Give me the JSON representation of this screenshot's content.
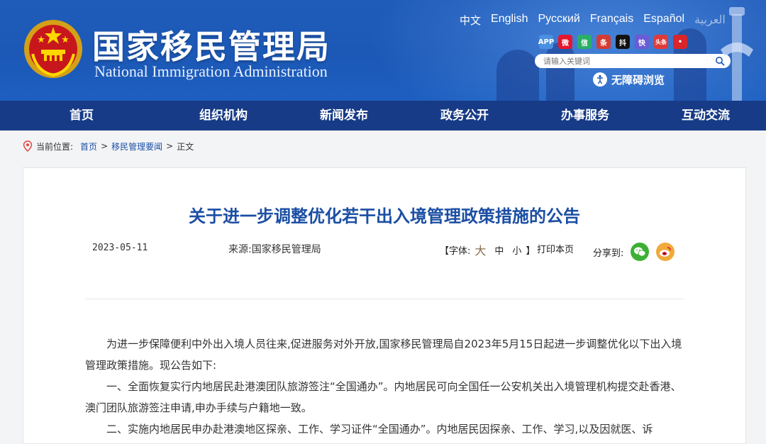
{
  "header": {
    "title_cn": "国家移民管理局",
    "title_en": "National Immigration Administration",
    "languages": [
      "中文",
      "English",
      "Русский",
      "Français",
      "Español",
      "العربية"
    ],
    "social_icons": [
      {
        "name": "app-icon",
        "label": "APP",
        "color": "#4a90e2"
      },
      {
        "name": "weibo-icon",
        "label": "微",
        "color": "#e6162d"
      },
      {
        "name": "wechat-icon",
        "label": "信",
        "color": "#2aae67"
      },
      {
        "name": "toutiao-icon",
        "label": "条",
        "color": "#d43c33"
      },
      {
        "name": "douyin-icon",
        "label": "抖",
        "color": "#111111"
      },
      {
        "name": "kuaishou-icon",
        "label": "快",
        "color": "#6b5bd6"
      },
      {
        "name": "toutiao-hao-icon",
        "label": "头条",
        "color": "#e03b3b"
      },
      {
        "name": "red-app-icon",
        "label": "•",
        "color": "#d8262a"
      }
    ],
    "search_placeholder": "请输入关键词",
    "accessible_label": "无障碍浏览"
  },
  "nav": {
    "items": [
      "首页",
      "组织机构",
      "新闻发布",
      "政务公开",
      "办事服务",
      "互动交流"
    ]
  },
  "breadcrumb": {
    "prefix": "当前位置:",
    "home": "首页",
    "section": "移民管理要闻",
    "current": "正文",
    "separator": ">"
  },
  "article": {
    "title": "关于进一步调整优化若干出入境管理政策措施的公告",
    "date": "2023-05-11",
    "source": "来源:国家移民管理局",
    "font_label_open": "【字体:",
    "font_large": "大",
    "font_medium": "中",
    "font_small": "小",
    "font_label_close": "】",
    "print_label": "打印本页",
    "share_label": "分享到:",
    "paragraphs": [
      "为进一步保障便利中外出入境人员往来,促进服务对外开放,国家移民管理局自2023年5月15日起进一步调整优化以下出入境管理政策措施。现公告如下:",
      "一、全面恢复实行内地居民赴港澳团队旅游签注“全国通办”。内地居民可向全国任一公安机关出入境管理机构提交赴香港、澳门团队旅游签注申请,申办手续与户籍地一致。",
      "二、实施内地居民申办赴港澳地区探亲、工作、学习证件“全国通办”。内地居民因探亲、工作、学习,以及因就医、诉"
    ]
  },
  "colors": {
    "header_blue": "#1f5bb8",
    "nav_blue": "#173b86",
    "title_blue": "#1b4ea3",
    "link_blue": "#1c4fa8"
  }
}
